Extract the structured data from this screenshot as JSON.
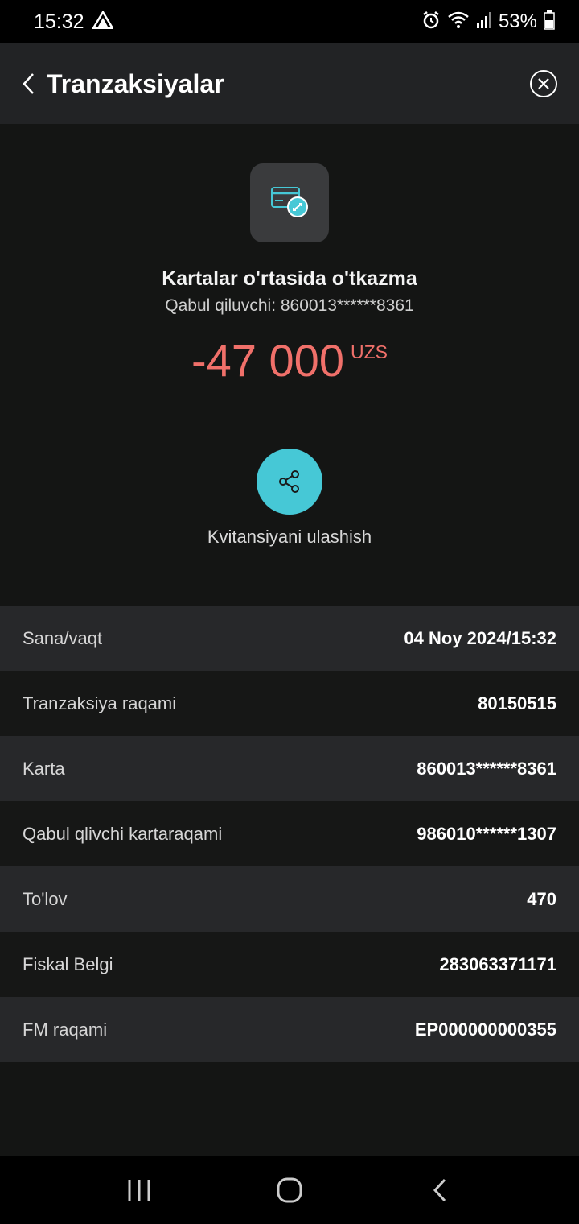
{
  "status_bar": {
    "time": "15:32",
    "battery": "53%"
  },
  "header": {
    "title": "Tranzaksiyalar"
  },
  "transaction": {
    "title": "Kartalar o'rtasida o'tkazma",
    "subtitle": "Qabul qiluvchi: 860013******8361",
    "amount": "-47 000",
    "currency": "UZS",
    "share_label": "Kvitansiyani ulashish"
  },
  "details": [
    {
      "label": "Sana/vaqt",
      "value": "04 Noy 2024/15:32"
    },
    {
      "label": "Tranzaksiya raqami",
      "value": "80150515"
    },
    {
      "label": "Karta",
      "value": "860013******8361"
    },
    {
      "label": "Qabul qlivchi kartaraqami",
      "value": "986010******1307"
    },
    {
      "label": "To'lov",
      "value": "470"
    },
    {
      "label": "Fiskal Belgi",
      "value": "283063371171"
    },
    {
      "label": "FM raqami",
      "value": "EP000000000355"
    }
  ],
  "colors": {
    "accent": "#46c8d6",
    "amount_negative": "#f0706a",
    "header_bg": "#222325",
    "page_bg": "#141514"
  },
  "icons": {
    "back": "chevron-left-icon",
    "close": "close-circle-icon",
    "transfer": "card-transfer-icon",
    "share": "share-icon"
  }
}
